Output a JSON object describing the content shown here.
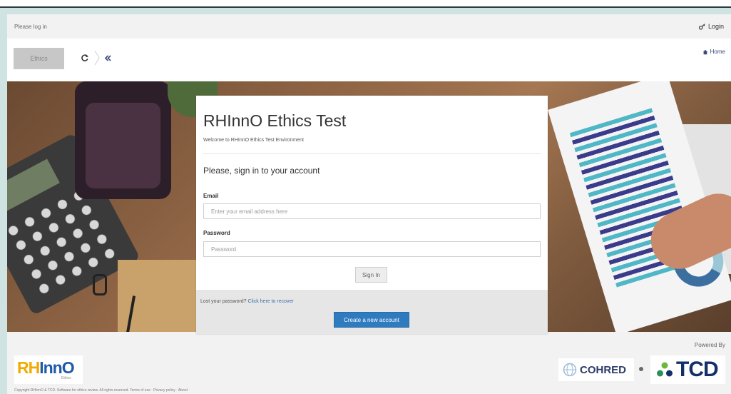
{
  "header": {
    "breadcrumb": "Please log in",
    "login_label": "Login"
  },
  "nav": {
    "logo_placeholder": "Ethics",
    "home_label": "Home"
  },
  "login_card": {
    "title": "RHInnO Ethics Test",
    "subtitle": "Welcome to RHInnO Ethics Test Environment",
    "heading": "Please, sign in to your account",
    "email_label": "Email",
    "email_placeholder": "Enter your email address here",
    "password_label": "Password",
    "password_placeholder": "Password",
    "signin_label": "Sign In",
    "lost_password_text": "Lost your password?",
    "recover_link": "Click here to recover",
    "create_account_label": "Create a new account"
  },
  "footer": {
    "powered_by": "Powered By",
    "rhinno_rh": "RH",
    "rhinno_inno": "InnO",
    "rhinno_sub": "Ethics",
    "cohred_label": "COHRED",
    "tcd_label": "TCD",
    "copyright": "Copyright RHInnO & TCD. Software for ethics review. All rights reserved. Terms of use · Privacy policy · About"
  },
  "colors": {
    "primary_button": "#2f7bbf",
    "link": "#3a6ea5",
    "rhinno_orange": "#f2a900",
    "rhinno_blue": "#1f5aa8"
  }
}
